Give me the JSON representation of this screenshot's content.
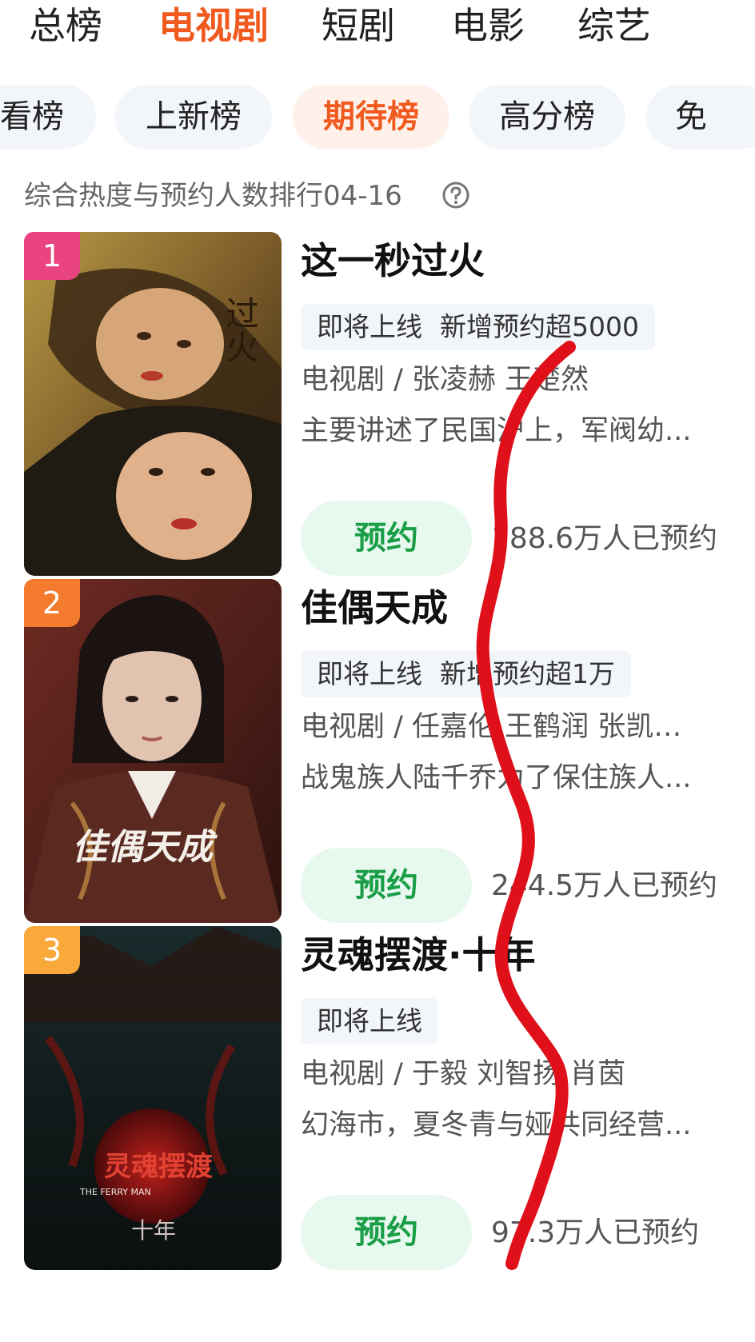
{
  "top_tabs": [
    "总榜",
    "电视剧",
    "短剧",
    "电影",
    "综艺"
  ],
  "sub_tabs": [
    "看榜",
    "上新榜",
    "期待榜",
    "高分榜",
    "免"
  ],
  "subtitle": "综合热度与预约人数排行04-16",
  "colors": {
    "accent": "#f05a1e",
    "reserve_green": "#1a9e47",
    "rank1": "#e9447f",
    "rank2": "#f47b2e",
    "rank3": "#f8a93a",
    "annotation": "#e0101a"
  },
  "items": [
    {
      "rank": "1",
      "title": "这一秒过火",
      "tags": [
        "即将上线",
        "新增预约超5000"
      ],
      "info": "电视剧 / 张凌赫 王楚然",
      "desc": "主要讲述了民国沪上，军阀幼...",
      "button": "预约",
      "count": "188.6万人已预约",
      "poster_text": "过火"
    },
    {
      "rank": "2",
      "title": "佳偶天成",
      "tags": [
        "即将上线",
        "新增预约超1万"
      ],
      "info": "电视剧 / 任嘉伦 王鹤润 张凯莹...",
      "desc": "战鬼族人陆千乔为了保住族人...",
      "button": "预约",
      "count": "244.5万人已预约",
      "poster_text": "佳偶天成"
    },
    {
      "rank": "3",
      "title": "灵魂摆渡·十年",
      "tags": [
        "即将上线"
      ],
      "info": "电视剧 / 于毅 刘智扬 肖茵",
      "desc": "幻海市，夏冬青与娅共同经营...",
      "button": "预约",
      "count": "97.3万人已预约",
      "poster_text": "灵魂摆渡",
      "poster_text_2": "十年",
      "poster_en": "THE FERRY MAN"
    }
  ]
}
